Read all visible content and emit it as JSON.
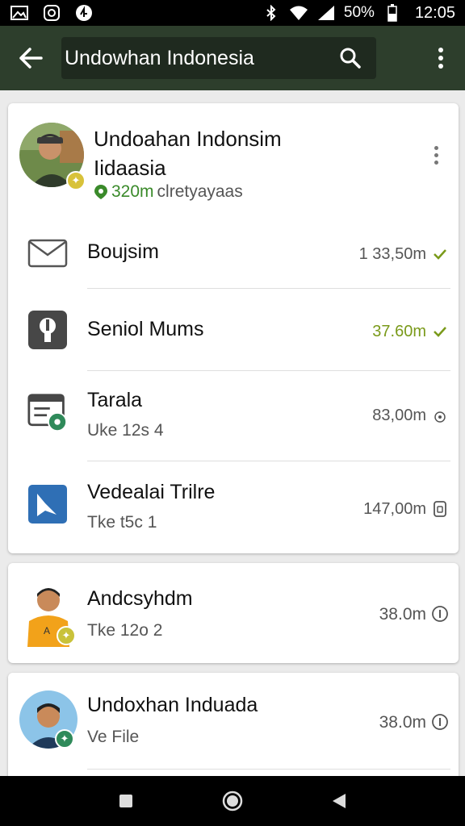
{
  "status_bar": {
    "battery": "50%",
    "time": "12:05"
  },
  "app_bar": {
    "search_query": "Undowhan Indonesia"
  },
  "profile": {
    "name_line1": "Undoahan Indonsim",
    "name_line2": "Iidaasia",
    "distance": "320m",
    "status": "clretyayaas"
  },
  "rows": [
    {
      "title": "Boujsim",
      "value": "1 33,50m",
      "icon": "envelope-icon",
      "trail": "check-icon"
    },
    {
      "title": "Seniol Mums",
      "value": "37.60m",
      "icon": "settings-badge-icon",
      "trail": "check-icon"
    },
    {
      "title": "Tarala",
      "subtitle": "Uke 12s 4",
      "value": "83,00m",
      "icon": "calendar-edit-icon",
      "trail": "clock-icon"
    },
    {
      "title": "Vedealai Trilre",
      "subtitle": "Tke t5c 1",
      "value": "147,00m",
      "icon": "app-logo-icon",
      "trail": "lock-icon"
    }
  ],
  "contacts": [
    {
      "title": "Andcsyhdm",
      "subtitle": "Tke 12o 2",
      "value": "38.0m"
    },
    {
      "title": "Undoxhan Induada",
      "subtitle": "Ve File",
      "value": "38.0m"
    }
  ],
  "colors": {
    "app_bar": "#2d3e2c",
    "accent_green": "#7a9a1a",
    "status_green": "#3a8a2a"
  }
}
